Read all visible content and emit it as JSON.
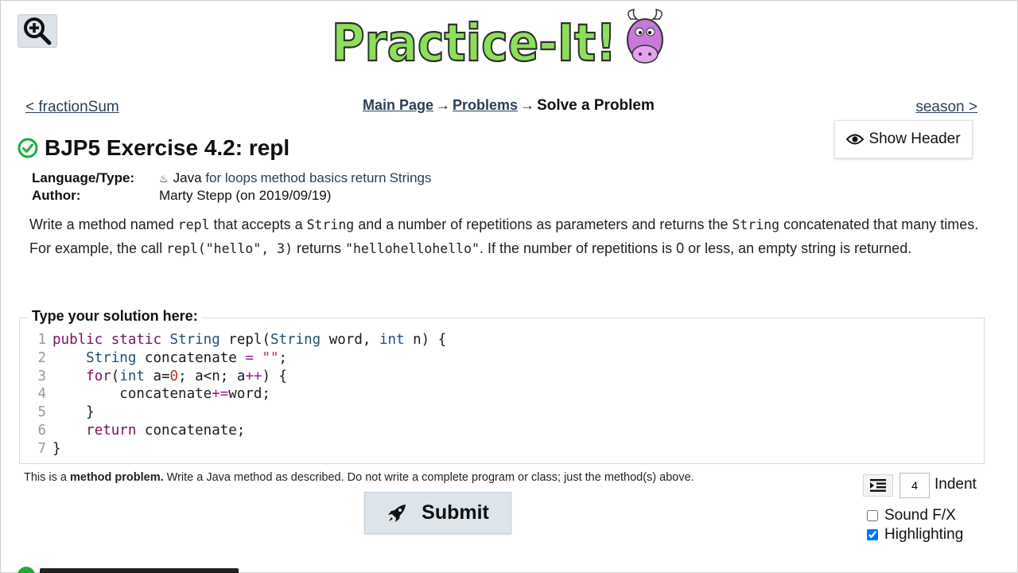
{
  "logo": {
    "text": "Practice-It!",
    "colors": {
      "letters": "#8ddf5b",
      "outline": "#2e2e2e",
      "cow": "#c679d9"
    }
  },
  "toolbar": {
    "zoom_icon": "zoom-in-icon"
  },
  "nav": {
    "prev": "< fractionSum",
    "next": "season >",
    "breadcrumb": {
      "main": "Main Page",
      "arrow": "→",
      "problems": "Problems",
      "current": "Solve a Problem"
    }
  },
  "show_header": {
    "label": "Show Header",
    "icon": "eye-icon"
  },
  "problem": {
    "solved_icon": "check-circle-icon",
    "title": "BJP5 Exercise 4.2: repl",
    "language_label": "Language/Type:",
    "language": "Java",
    "tags": [
      "for loops",
      "method basics",
      "return",
      "Strings"
    ],
    "author_label": "Author:",
    "author": "Marty Stepp (on 2019/09/19)",
    "description": {
      "p1": "Write a method named ",
      "c1": "repl",
      "p2": " that accepts a ",
      "c2": "String",
      "p3": " and a number of repetitions as parameters and returns the ",
      "c3": "String",
      "p4": " concatenated that many times. For example, the call ",
      "c4": "repl(\"hello\", 3)",
      "p5": " returns ",
      "c5": "\"hellohellohello\"",
      "p6": ". If the number of repetitions is 0 or less, an empty string is returned."
    }
  },
  "solution": {
    "legend": "Type your solution here:",
    "line_numbers": [
      "1",
      "2",
      "3",
      "4",
      "5",
      "6",
      "7"
    ],
    "tokens": {
      "public": "public",
      "static": "static",
      "String": "String",
      "repl": "repl(",
      "paramType": "String",
      "word": " word, ",
      "int": "int",
      "n": " n) {",
      "concatenate": " concatenate ",
      "eq": "=",
      "empty": "\"\"",
      "semi": ";",
      "for": "for",
      "forOpen": "(",
      "a0": " a=",
      "zero": "0",
      "cond": "; a<n; a",
      "inc": "++",
      "forClose": ") {",
      "body": "concatenate",
      "pluseq": "+=",
      "bodyEnd": "word;",
      "closeBrace": "}",
      "return": "return",
      "retVal": " concatenate;",
      "closeMethod": "}"
    }
  },
  "footer": {
    "note_prefix": "This is a ",
    "note_bold": "method problem.",
    "note_suffix": " Write a Java method as described. Do not write a complete program or class; just the method(s) above.",
    "submit_label": "Submit",
    "submit_icon": "rocket-icon",
    "indent_icon": "indent-icon",
    "indent_value": "4",
    "indent_label": "Indent",
    "sound_label": "Sound F/X",
    "sound_checked": false,
    "highlight_label": "Highlighting",
    "highlight_checked": true
  }
}
